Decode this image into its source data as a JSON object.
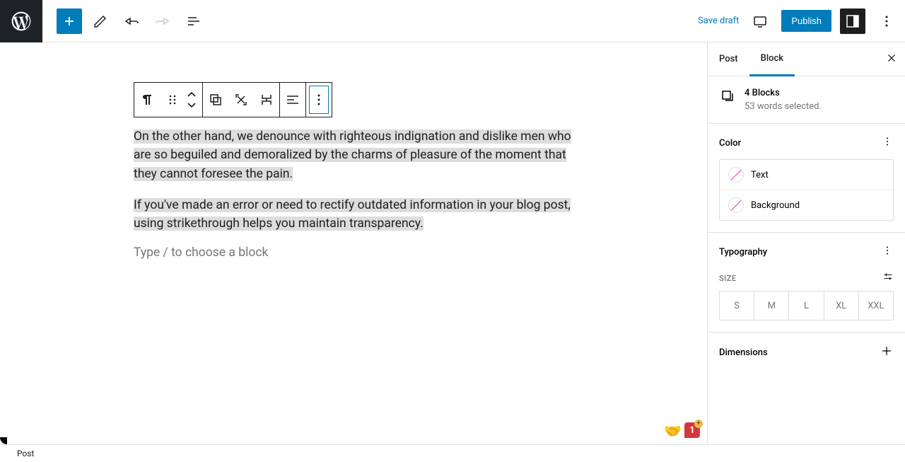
{
  "topbar": {
    "save_draft": "Save draft",
    "publish": "Publish"
  },
  "editor": {
    "para1": "On the other hand, we denounce with righteous indignation and dislike men who are so beguiled and demoralized by the charms of pleasure of the moment that they cannot foresee the pain.",
    "para2": "If you've made an error or need to rectify outdated information in your blog post, using strikethrough helps you maintain transparency.",
    "placeholder": "Type / to choose a block"
  },
  "sidebar": {
    "tabs": {
      "post": "Post",
      "block": "Block"
    },
    "block_info": {
      "title": "4 Blocks",
      "sub": "53 words selected."
    },
    "color": {
      "title": "Color",
      "text": "Text",
      "background": "Background"
    },
    "typography": {
      "title": "Typography",
      "size_label": "SIZE",
      "sizes": [
        "S",
        "M",
        "L",
        "XL",
        "XXL"
      ]
    },
    "dimensions": {
      "title": "Dimensions"
    }
  },
  "footer": {
    "breadcrumb": "Post"
  },
  "badge": {
    "count": "1"
  }
}
